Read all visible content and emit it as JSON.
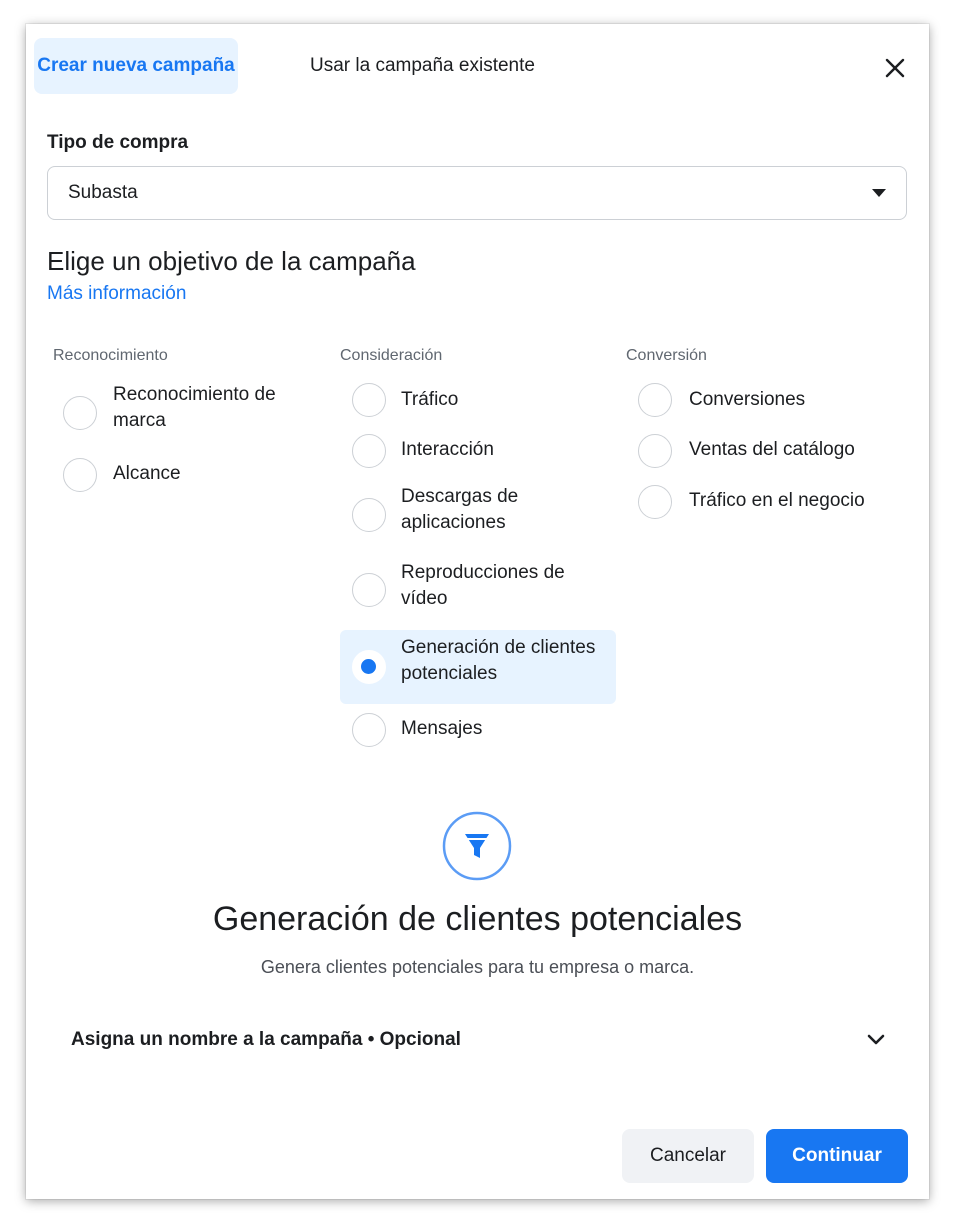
{
  "header": {
    "tabs": [
      {
        "label": "Crear nueva campaña",
        "active": true
      },
      {
        "label": "Usar la campaña existente",
        "active": false
      }
    ],
    "close_icon": "close-icon"
  },
  "buying_type": {
    "label": "Tipo de compra",
    "value": "Subasta"
  },
  "objective": {
    "title": "Elige un objetivo de la campaña",
    "more_info": "Más información",
    "columns": [
      {
        "title": "Reconocimiento",
        "options": [
          {
            "label": "Reconocimiento de marca",
            "selected": false
          },
          {
            "label": "Alcance",
            "selected": false
          }
        ]
      },
      {
        "title": "Consideración",
        "options": [
          {
            "label": "Tráfico",
            "selected": false
          },
          {
            "label": "Interacción",
            "selected": false
          },
          {
            "label": "Descargas de aplicaciones",
            "selected": false
          },
          {
            "label": "Reproducciones de vídeo",
            "selected": false
          },
          {
            "label": "Generación de clientes potenciales",
            "selected": true
          },
          {
            "label": "Mensajes",
            "selected": false
          }
        ]
      },
      {
        "title": "Conversión",
        "options": [
          {
            "label": "Conversiones",
            "selected": false
          },
          {
            "label": "Ventas del catálogo",
            "selected": false
          },
          {
            "label": "Tráfico en el negocio",
            "selected": false
          }
        ]
      }
    ]
  },
  "selected_objective": {
    "icon": "funnel-icon",
    "title": "Generación de clientes potenciales",
    "description": "Genera clientes potenciales para tu empresa o marca."
  },
  "campaign_name": {
    "label": "Asigna un nombre a la campaña • Opcional"
  },
  "footer": {
    "cancel_label": "Cancelar",
    "continue_label": "Continuar"
  },
  "colors": {
    "accent": "#1877f2",
    "accent_light": "#e7f3ff",
    "secondary_button": "#f0f2f5"
  }
}
